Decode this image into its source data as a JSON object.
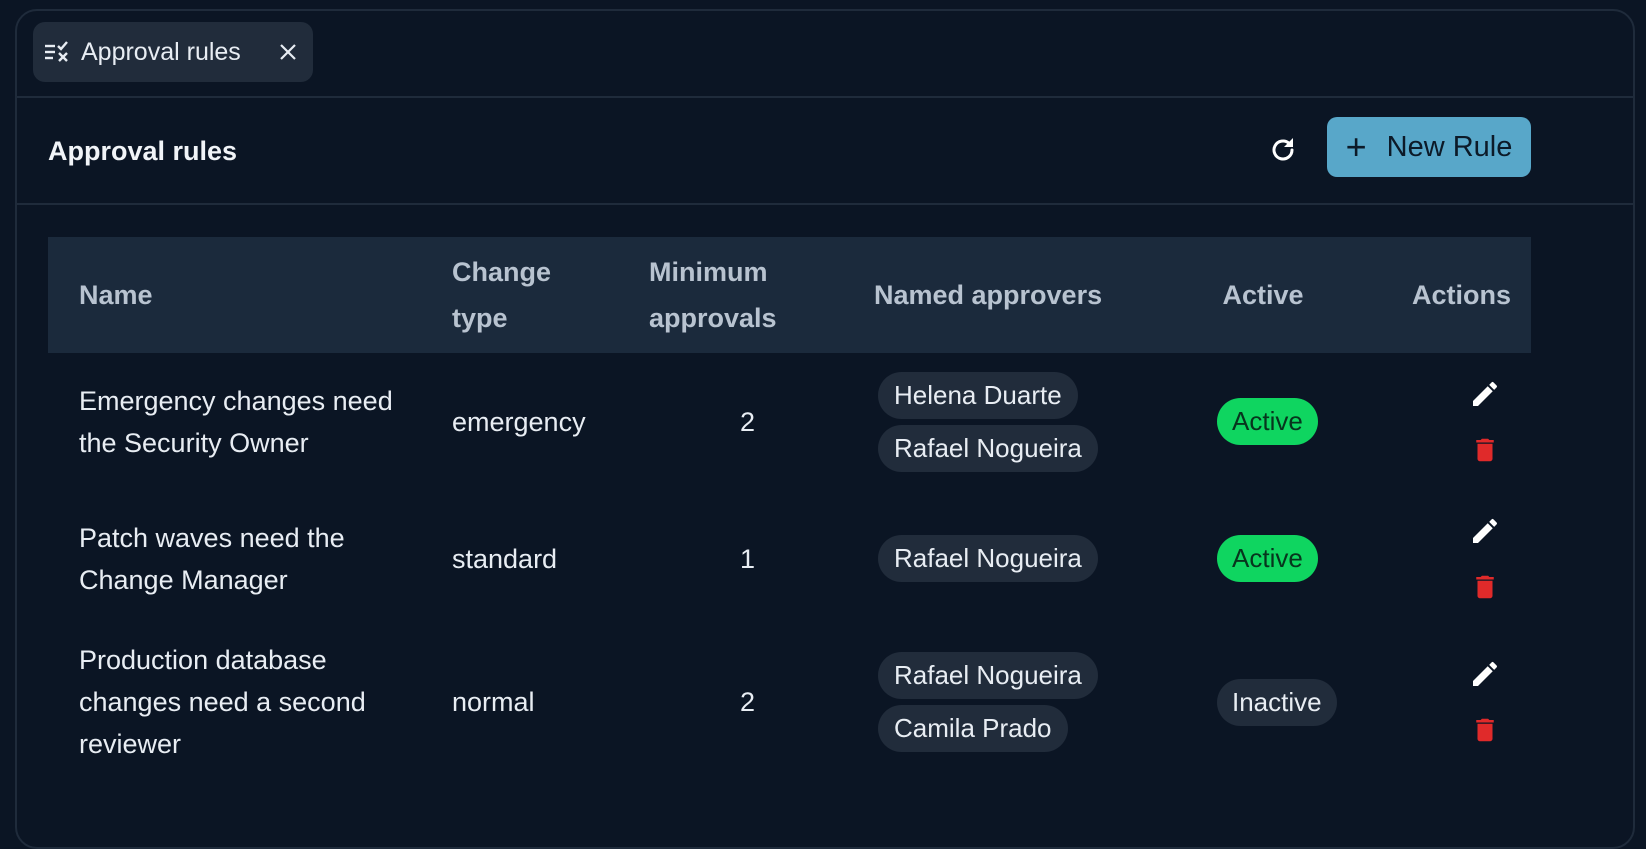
{
  "tab": {
    "label": "Approval rules",
    "icon": "rules-list-icon",
    "close_icon": "close-icon"
  },
  "header": {
    "title": "Approval rules",
    "refresh_icon": "refresh-icon",
    "new_rule_label": "New Rule"
  },
  "table": {
    "columns": {
      "name": "Name",
      "change_type": [
        "Change",
        "type"
      ],
      "minimum_approvals": [
        "Minimum",
        "approvals"
      ],
      "named_approvers": "Named approvers",
      "active": "Active",
      "actions": "Actions"
    },
    "rows": [
      {
        "name": [
          "Emergency changes need",
          "the Security Owner"
        ],
        "change_type": "emergency",
        "minimum_approvals": "2",
        "approvers": [
          "Helena Duarte",
          "Rafael Nogueira"
        ],
        "status": "Active"
      },
      {
        "name": [
          "Patch waves need the",
          "Change Manager"
        ],
        "change_type": "standard",
        "minimum_approvals": "1",
        "approvers": [
          "Rafael Nogueira"
        ],
        "status": "Active"
      },
      {
        "name": [
          "Production database",
          "changes need a second",
          "reviewer"
        ],
        "change_type": "normal",
        "minimum_approvals": "2",
        "approvers": [
          "Rafael Nogueira",
          "Camila Prado"
        ],
        "status": "Inactive"
      }
    ]
  },
  "colors": {
    "background": "#0b1524",
    "header_row": "#1b2a3c",
    "accent": "#58a7c9",
    "active_badge": "#0fd560",
    "delete": "#e02a2a"
  }
}
